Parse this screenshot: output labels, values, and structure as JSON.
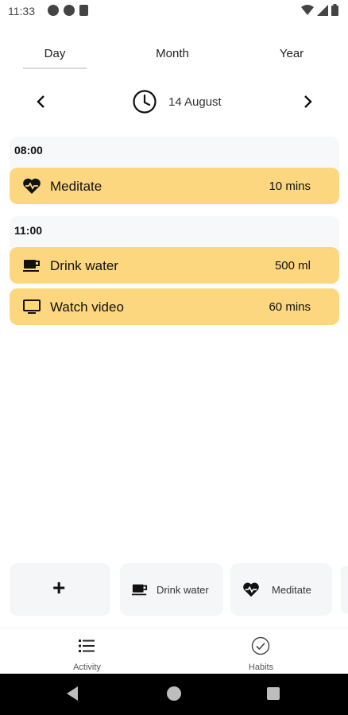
{
  "status_bar": {
    "time": "11:33"
  },
  "tabs": [
    {
      "label": "Day",
      "selected": true
    },
    {
      "label": "Month",
      "selected": false
    },
    {
      "label": "Year",
      "selected": false
    }
  ],
  "date_nav": {
    "date": "14 August"
  },
  "schedule": [
    {
      "time": "08:00",
      "activities": [
        {
          "name": "Meditate",
          "value": "10 mins",
          "icon": "heart-pulse-icon"
        }
      ]
    },
    {
      "time": "11:00",
      "activities": [
        {
          "name": "Drink water",
          "value": "500 ml",
          "icon": "cup-icon"
        },
        {
          "name": "Watch video",
          "value": "60 mins",
          "icon": "monitor-icon"
        }
      ]
    }
  ],
  "quick_actions": {
    "add_symbol": "+",
    "items": [
      {
        "label": "Drink water",
        "icon": "cup-icon"
      },
      {
        "label": "Meditate",
        "icon": "heart-pulse-icon"
      }
    ]
  },
  "bottom_nav": [
    {
      "label": "Activity",
      "icon": "list-icon"
    },
    {
      "label": "Habits",
      "icon": "check-circle-icon"
    }
  ],
  "colors": {
    "accent": "#fcd77f",
    "card_bg": "#f5f6f8",
    "system_bar": "#000000"
  }
}
